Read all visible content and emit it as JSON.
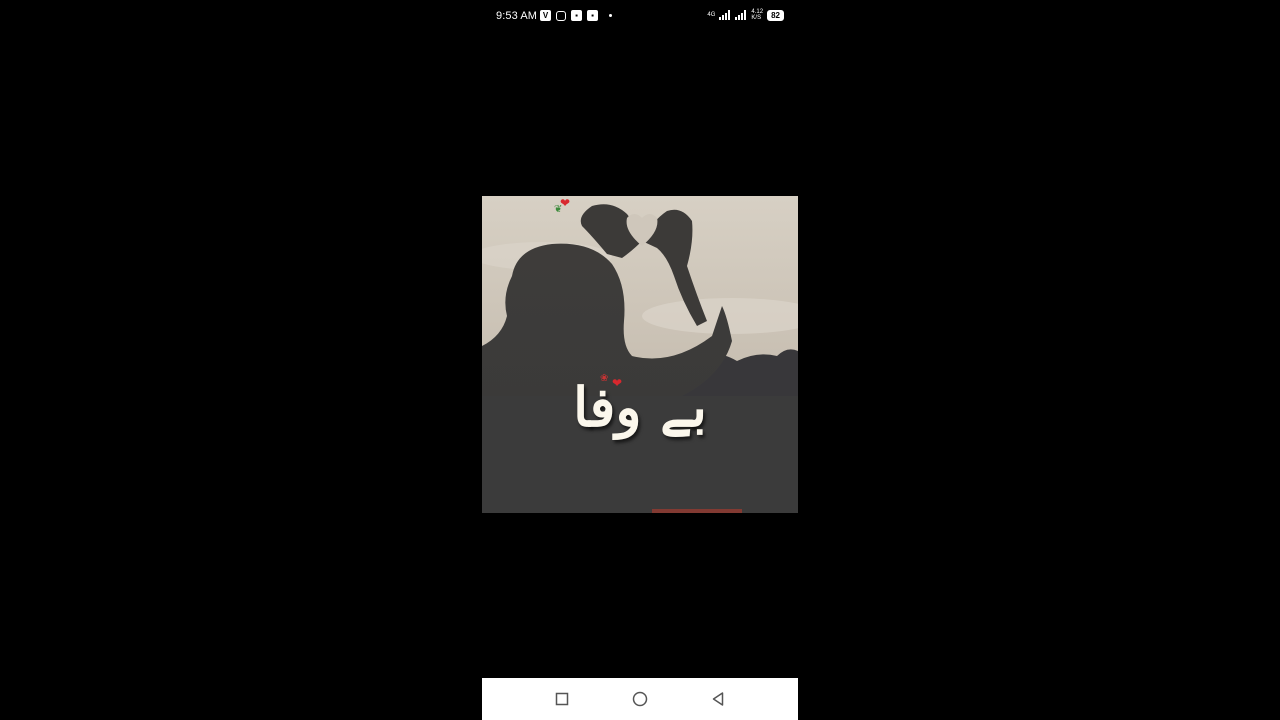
{
  "status_bar": {
    "time": "9:53 AM",
    "network_label_top": "4G",
    "network_label_bottom": "4G",
    "speed_top": "4.12",
    "speed_bottom": "K/S",
    "battery": "82"
  },
  "content": {
    "caption": "بے وفا"
  },
  "nav": {
    "icons": [
      "recent-apps-icon",
      "home-icon",
      "back-icon"
    ]
  }
}
